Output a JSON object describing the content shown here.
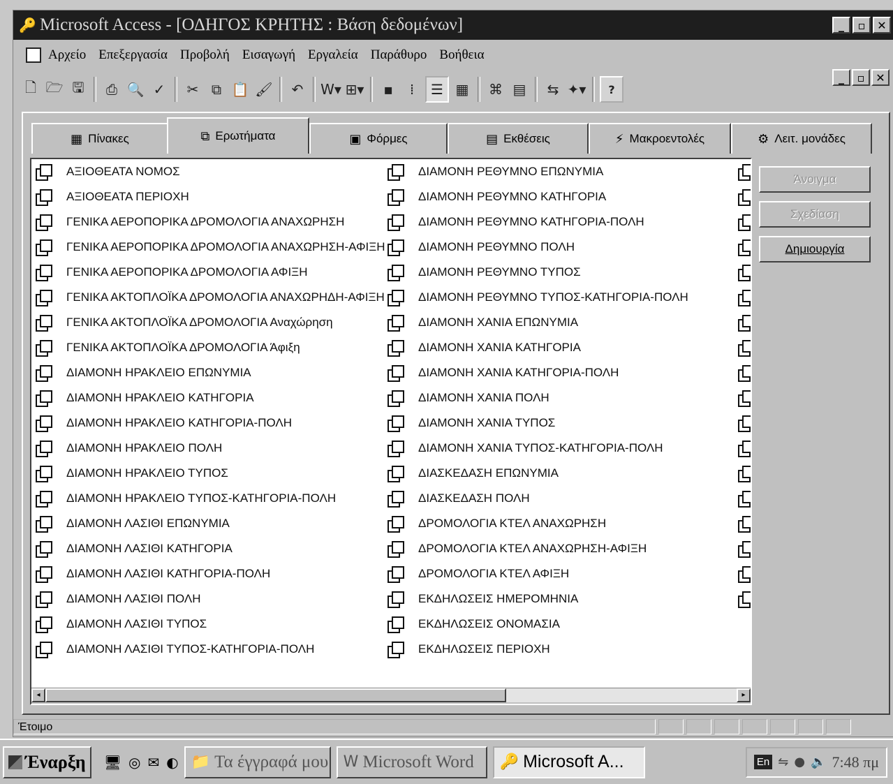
{
  "window": {
    "title": "Microsoft Access - [ΟΔΗΓΟΣ ΚΡΗΤΗΣ : Βάση δεδομένων]"
  },
  "menu": [
    {
      "label": "Αρχείο"
    },
    {
      "label": "Επεξεργασία"
    },
    {
      "label": "Προβολή"
    },
    {
      "label": "Εισαγωγή"
    },
    {
      "label": "Εργαλεία"
    },
    {
      "label": "Παράθυρο"
    },
    {
      "label": "Βοήθεια"
    }
  ],
  "tabs": [
    {
      "label": "Πίνακες",
      "icon": "table-icon"
    },
    {
      "label": "Ερωτήματα",
      "icon": "query-icon"
    },
    {
      "label": "Φόρμες",
      "icon": "form-icon"
    },
    {
      "label": "Εκθέσεις",
      "icon": "report-icon"
    },
    {
      "label": "Μακροεντολές",
      "icon": "macro-icon"
    },
    {
      "label": "Λειτ. μονάδες",
      "icon": "module-icon"
    }
  ],
  "active_tab": "Ερωτήματα",
  "queries_col1": [
    "ΑΞΙΟΘΕΑΤΑ ΝΟΜΟΣ",
    "ΑΞΙΟΘΕΑΤΑ ΠΕΡΙΟΧΗ",
    "ΓΕΝΙΚΑ ΑΕΡΟΠΟΡΙΚΑ ΔΡΟΜΟΛΟΓΙΑ ΑΝΑΧΩΡΗΣΗ",
    "ΓΕΝΙΚΑ ΑΕΡΟΠΟΡΙΚΑ ΔΡΟΜΟΛΟΓΙΑ ΑΝΑΧΩΡΗΣΗ-ΑΦΙΞΗ",
    "ΓΕΝΙΚΑ ΑΕΡΟΠΟΡΙΚΑ ΔΡΟΜΟΛΟΓΙΑ ΑΦΙΞΗ",
    "ΓΕΝΙΚΑ ΑΚΤΟΠΛΟΪΚΑ ΔΡΟΜΟΛΟΓΙΑ ΑΝΑΧΩΡΗΔΗ-ΑΦΙΞΗ",
    "ΓΕΝΙΚΑ ΑΚΤΟΠΛΟΪΚΑ ΔΡΟΜΟΛΟΓΙΑ Αναχώρηση",
    "ΓΕΝΙΚΑ ΑΚΤΟΠΛΟΪΚΑ ΔΡΟΜΟΛΟΓΙΑ Άφιξη",
    "ΔΙΑΜΟΝΗ ΗΡΑΚΛΕΙΟ ΕΠΩΝΥΜΙΑ",
    "ΔΙΑΜΟΝΗ ΗΡΑΚΛΕΙΟ ΚΑΤΗΓΟΡΙΑ",
    "ΔΙΑΜΟΝΗ ΗΡΑΚΛΕΙΟ ΚΑΤΗΓΟΡΙΑ-ΠΟΛΗ",
    "ΔΙΑΜΟΝΗ ΗΡΑΚΛΕΙΟ ΠΟΛΗ",
    "ΔΙΑΜΟΝΗ ΗΡΑΚΛΕΙΟ ΤΥΠΟΣ",
    "ΔΙΑΜΟΝΗ ΗΡΑΚΛΕΙΟ ΤΥΠΟΣ-ΚΑΤΗΓΟΡΙΑ-ΠΟΛΗ",
    "ΔΙΑΜΟΝΗ ΛΑΣΙΘΙ ΕΠΩΝΥΜΙΑ",
    "ΔΙΑΜΟΝΗ ΛΑΣΙΘΙ ΚΑΤΗΓΟΡΙΑ",
    "ΔΙΑΜΟΝΗ ΛΑΣΙΘΙ ΚΑΤΗΓΟΡΙΑ-ΠΟΛΗ",
    "ΔΙΑΜΟΝΗ ΛΑΣΙΘΙ ΠΟΛΗ",
    "ΔΙΑΜΟΝΗ ΛΑΣΙΘΙ ΤΥΠΟΣ",
    "ΔΙΑΜΟΝΗ ΛΑΣΙΘΙ ΤΥΠΟΣ-ΚΑΤΗΓΟΡΙΑ-ΠΟΛΗ"
  ],
  "queries_col2": [
    "ΔΙΑΜΟΝΗ ΡΕΘΥΜΝΟ ΕΠΩΝΥΜΙΑ",
    "ΔΙΑΜΟΝΗ ΡΕΘΥΜΝΟ ΚΑΤΗΓΟΡΙΑ",
    "ΔΙΑΜΟΝΗ ΡΕΘΥΜΝΟ ΚΑΤΗΓΟΡΙΑ-ΠΟΛΗ",
    "ΔΙΑΜΟΝΗ ΡΕΘΥΜΝΟ ΠΟΛΗ",
    "ΔΙΑΜΟΝΗ ΡΕΘΥΜΝΟ ΤΥΠΟΣ",
    "ΔΙΑΜΟΝΗ ΡΕΘΥΜΝΟ ΤΥΠΟΣ-ΚΑΤΗΓΟΡΙΑ-ΠΟΛΗ",
    "ΔΙΑΜΟΝΗ ΧΑΝΙΑ ΕΠΩΝΥΜΙΑ",
    "ΔΙΑΜΟΝΗ ΧΑΝΙΑ ΚΑΤΗΓΟΡΙΑ",
    "ΔΙΑΜΟΝΗ ΧΑΝΙΑ ΚΑΤΗΓΟΡΙΑ-ΠΟΛΗ",
    "ΔΙΑΜΟΝΗ ΧΑΝΙΑ ΠΟΛΗ",
    "ΔΙΑΜΟΝΗ ΧΑΝΙΑ ΤΥΠΟΣ",
    "ΔΙΑΜΟΝΗ ΧΑΝΙΑ ΤΥΠΟΣ-ΚΑΤΗΓΟΡΙΑ-ΠΟΛΗ",
    "ΔΙΑΣΚΕΔΑΣΗ ΕΠΩΝΥΜΙΑ",
    "ΔΙΑΣΚΕΔΑΣΗ ΠΟΛΗ",
    "ΔΡΟΜΟΛΟΓΙΑ ΚΤΕΛ ΑΝΑΧΩΡΗΣΗ",
    "ΔΡΟΜΟΛΟΓΙΑ ΚΤΕΛ ΑΝΑΧΩΡΗΣΗ-ΑΦΙΞΗ",
    "ΔΡΟΜΟΛΟΓΙΑ ΚΤΕΛ ΑΦΙΞΗ",
    "ΕΚΔΗΛΩΣΕΙΣ ΗΜΕΡΟΜΗΝΙΑ",
    "ΕΚΔΗΛΩΣΕΙΣ ΟΝΟΜΑΣΙΑ",
    "ΕΚΔΗΛΩΣΕΙΣ ΠΕΡΙΟΧΗ"
  ],
  "side_buttons": [
    {
      "label": "Άνοιγμα",
      "enabled": false
    },
    {
      "label": "Σχεδίαση",
      "enabled": false
    },
    {
      "label": "Δημιουργία",
      "enabled": true
    }
  ],
  "status": {
    "text": "Έτοιμο"
  },
  "taskbar": {
    "start_label": "Έναρξη",
    "tasks": [
      {
        "label": "Τα έγγραφά μου",
        "icon": "folder-icon",
        "active": false
      },
      {
        "label": "Microsoft Word",
        "icon": "word-icon",
        "active": false
      },
      {
        "label": "Microsoft A...",
        "icon": "access-icon",
        "active": true
      }
    ],
    "lang": "En",
    "clock": "7:48 πμ"
  }
}
